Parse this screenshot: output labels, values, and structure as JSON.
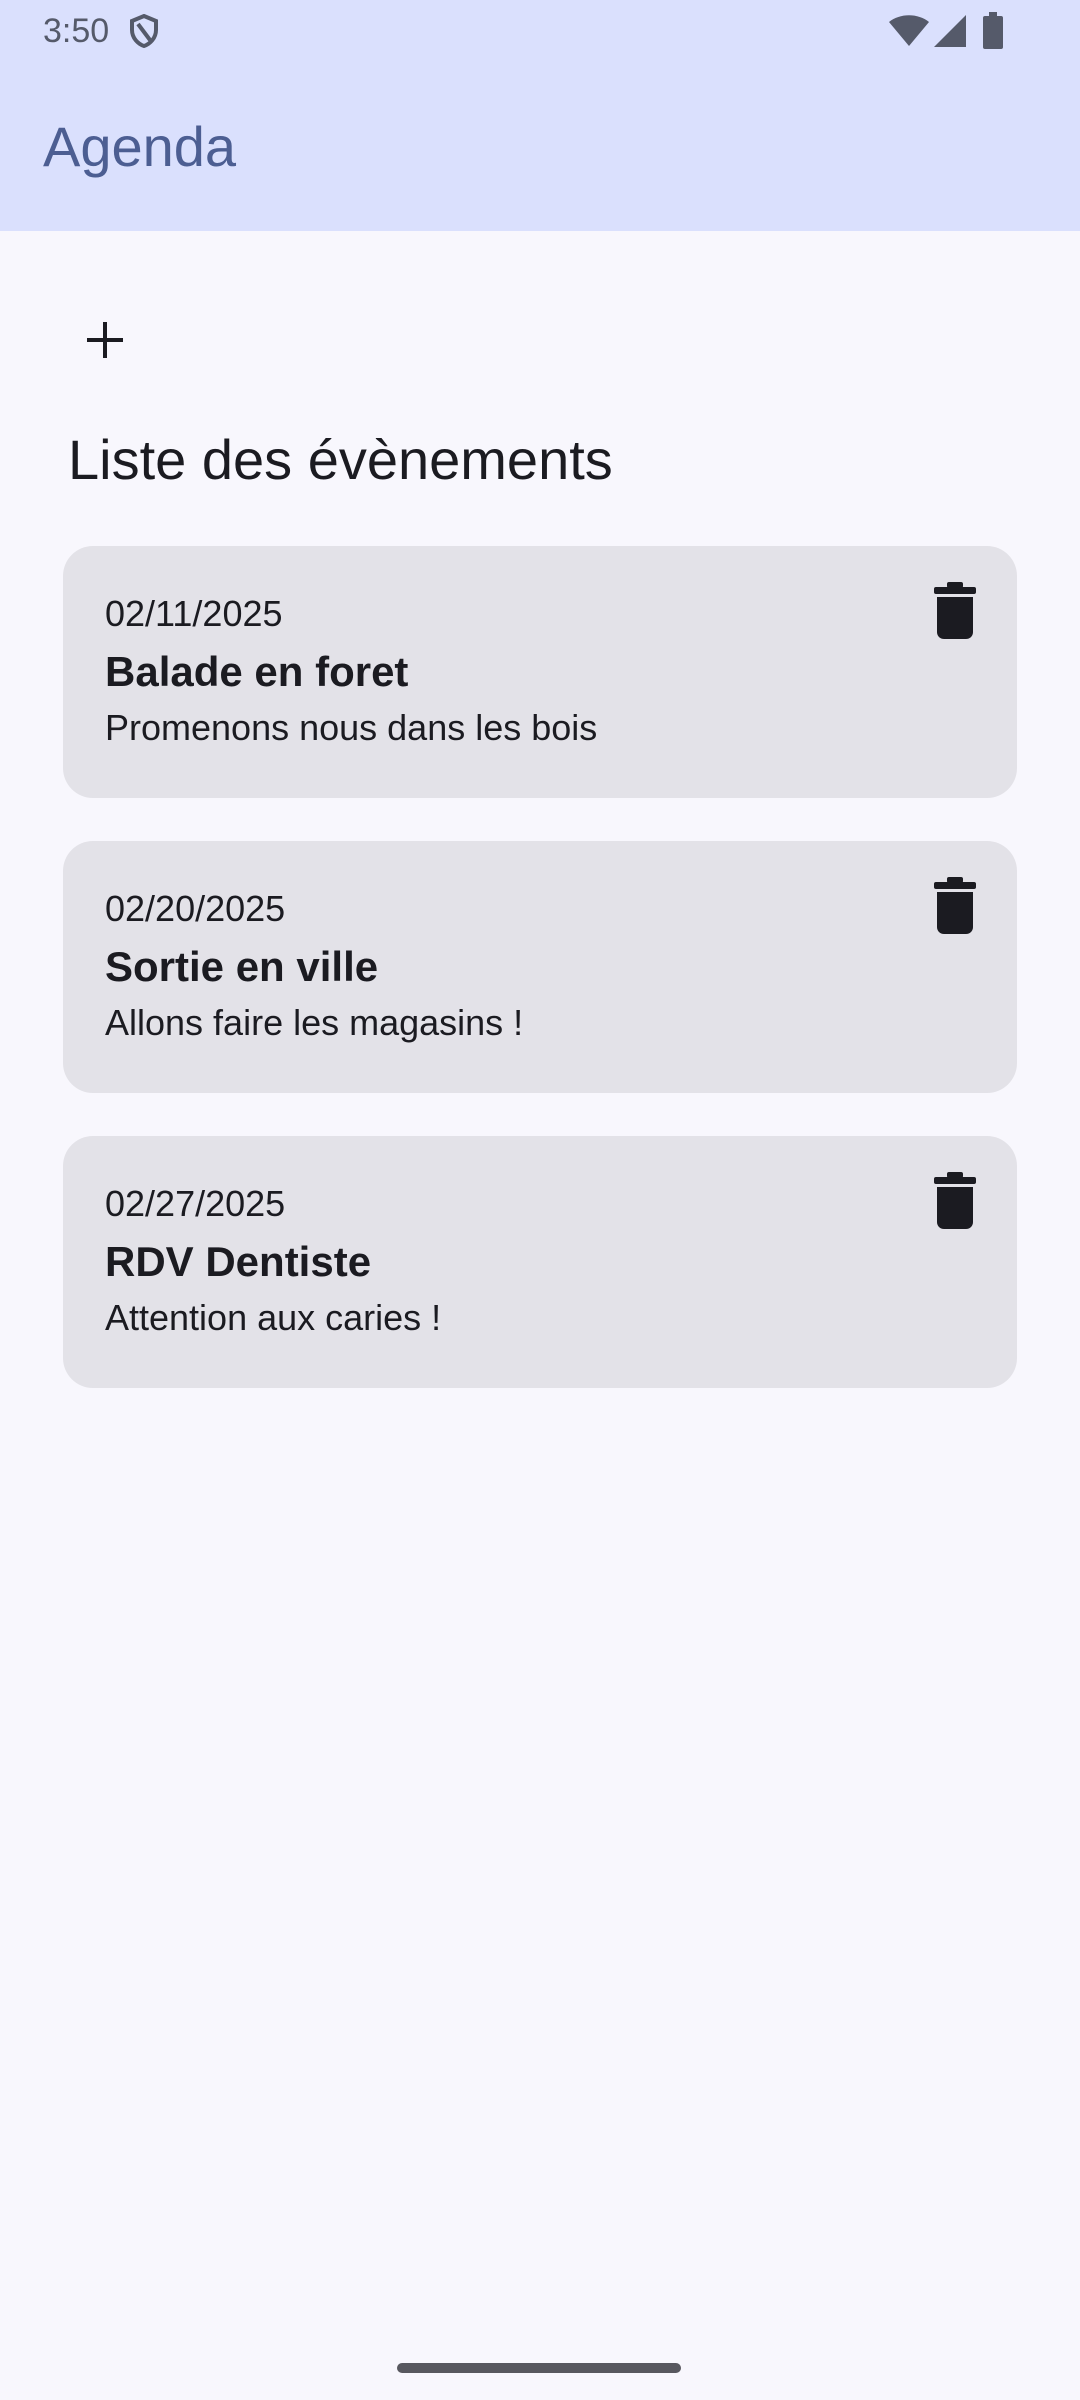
{
  "status_bar": {
    "time": "3:50",
    "icons": [
      "shield-icon",
      "wifi-icon",
      "signal-icon",
      "battery-icon"
    ]
  },
  "app_bar": {
    "title": "Agenda"
  },
  "add_button": {
    "icon": "plus-icon"
  },
  "section": {
    "title": "Liste des évènements"
  },
  "events": [
    {
      "date": "02/11/2025",
      "title": "Balade en foret",
      "description": "Promenons nous dans les bois"
    },
    {
      "date": "02/20/2025",
      "title": "Sortie en ville",
      "description": "Allons faire les magasins !"
    },
    {
      "date": "02/27/2025",
      "title": "RDV Dentiste",
      "description": "Attention aux caries !"
    }
  ],
  "colors": {
    "app_bar_background": "#DAE0FD",
    "app_title": "#4C5E92",
    "page_background": "#F8F7FD",
    "card_background": "#E3E2E8",
    "text_primary": "#1B1B21"
  }
}
